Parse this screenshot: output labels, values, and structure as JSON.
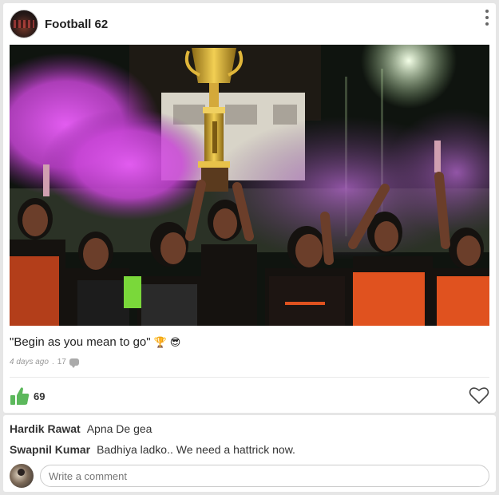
{
  "post": {
    "author": "Football 62",
    "caption_text": "\"Begin as you mean to go\"",
    "caption_emoji_1": "🏆",
    "caption_emoji_2": "😎",
    "time_ago": "4 days ago",
    "separator": ".",
    "comment_count": "17",
    "like_count": "69",
    "photo_label": "trophy celebration photo"
  },
  "comments": [
    {
      "name": "Hardik Rawat",
      "text": "Apna De gea"
    },
    {
      "name": "Swapnil Kumar",
      "text": "Badhiya ladko.. We need a hattrick now."
    }
  ],
  "composer": {
    "placeholder": "Write a comment"
  },
  "colors": {
    "like": "#5cb85c",
    "smoke": "#d34fe0",
    "jersey": "#e0521f"
  }
}
